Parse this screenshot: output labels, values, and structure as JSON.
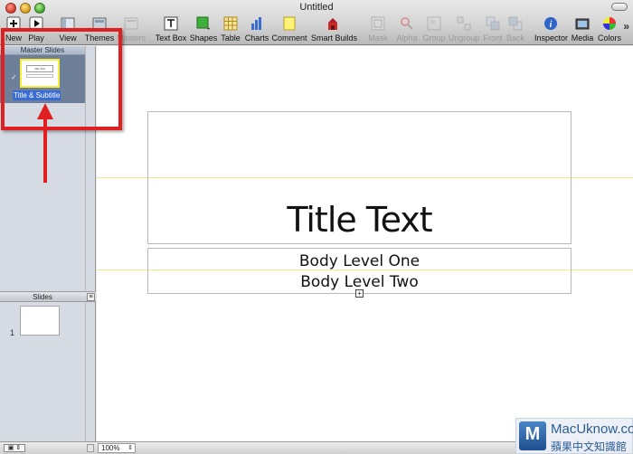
{
  "window": {
    "title": "Untitled"
  },
  "toolbar": {
    "items": [
      {
        "label": "New",
        "icon": "plus-icon"
      },
      {
        "label": "Play",
        "icon": "play-icon"
      },
      {
        "label": "View",
        "icon": "view-icon"
      },
      {
        "label": "Themes",
        "icon": "themes-icon"
      },
      {
        "label": "Masters",
        "icon": "masters-icon",
        "disabled": true
      },
      {
        "label": "Text Box",
        "icon": "text-box-icon"
      },
      {
        "label": "Shapes",
        "icon": "shapes-icon"
      },
      {
        "label": "Table",
        "icon": "table-icon"
      },
      {
        "label": "Charts",
        "icon": "charts-icon"
      },
      {
        "label": "Comment",
        "icon": "comment-icon"
      },
      {
        "label": "Smart Builds",
        "icon": "smart-builds-icon"
      },
      {
        "label": "Mask",
        "icon": "mask-icon",
        "disabled": true
      },
      {
        "label": "Alpha",
        "icon": "alpha-icon",
        "disabled": true
      },
      {
        "label": "Group",
        "icon": "group-icon",
        "disabled": true
      },
      {
        "label": "Ungroup",
        "icon": "ungroup-icon",
        "disabled": true
      },
      {
        "label": "Front",
        "icon": "front-icon",
        "disabled": true
      },
      {
        "label": "Back",
        "icon": "back-icon",
        "disabled": true
      },
      {
        "label": "Inspector",
        "icon": "inspector-icon"
      },
      {
        "label": "Media",
        "icon": "media-icon"
      },
      {
        "label": "Colors",
        "icon": "colors-icon"
      }
    ],
    "overflow": "»"
  },
  "navigator": {
    "master_header": "Master Slides",
    "master_selected_label": "Title & Subtitle",
    "master_thumb_title": "Title Text",
    "slides_header": "Slides",
    "slides_menu_glyph": "≡",
    "slides": [
      {
        "number": "1"
      }
    ]
  },
  "slide": {
    "title": "Title Text",
    "body_level_one": "Body Level One",
    "body_level_two": "Body Level Two"
  },
  "bottombar": {
    "zoom": "100%"
  },
  "watermark": {
    "brand": "MacUknow.com",
    "subtitle": "蘋果中文知識館",
    "logo_letter": "M"
  },
  "colors": {
    "annotation": "#e02020",
    "selection": "#3a6cd6",
    "guide": "#eee98a",
    "master_thumb_border": "#f6ef3a"
  }
}
